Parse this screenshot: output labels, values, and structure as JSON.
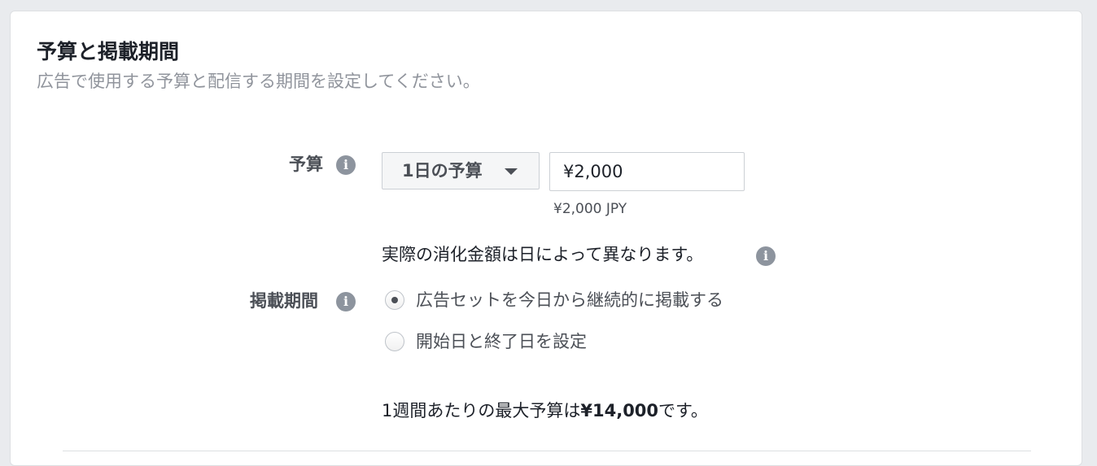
{
  "section": {
    "title": "予算と掲載期間",
    "subtitle": "広告で使用する予算と配信する期間を設定してください。"
  },
  "budget": {
    "label": "予算",
    "type_dropdown": {
      "selected": "1日の予算"
    },
    "amount_value": "¥2,000",
    "currency_note": "¥2,000 JPY",
    "actual_spend_note": "実際の消化金額は日によって異なります。"
  },
  "schedule": {
    "label": "掲載期間",
    "options": [
      {
        "label": "広告セットを今日から継続的に掲載する",
        "selected": true
      },
      {
        "label": "開始日と終了日を設定",
        "selected": false
      }
    ]
  },
  "weekly_max": {
    "prefix": "1週間あたりの最大予算は",
    "amount": "¥14,000",
    "suffix": "です。"
  },
  "icons": {
    "info": "info-icon",
    "dropdown_caret": "caret-down-icon",
    "info_glyph": "i"
  },
  "colors": {
    "page_background": "#e9ebee",
    "card_background": "#ffffff",
    "title_text": "#1d2129",
    "subtitle_text": "#90949c",
    "label_text": "#4b4f56",
    "info_icon_bg": "#8d949e"
  }
}
